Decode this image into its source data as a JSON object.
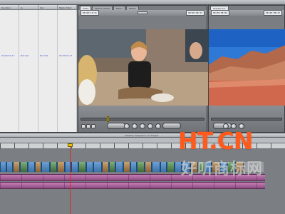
{
  "browser": {
    "columns": [
      "Duration",
      "In",
      "Out",
      "Media Start"
    ],
    "selected_row": [
      "00:00:01:17",
      "Not Set",
      "Not Set",
      "00:00:01:17"
    ]
  },
  "viewer": {
    "tabs": [
      "Video",
      "Stereo (a1a2)",
      "Filters",
      "Motion"
    ],
    "timecode_left": "00:00:14:31",
    "timecode_right": "00:00:00:27"
  },
  "canvas": {
    "tabs": [
      "Sequence 1"
    ],
    "timecode_left": "00:00:08:04",
    "timecode_right": "00:00:08:27"
  },
  "timeline": {
    "title": "Timeline: Sequence 1 in Project",
    "playhead_fraction": 0.245
  },
  "watermark": {
    "logo": "HT.CN",
    "tagline": "好听商标网"
  },
  "colors": {
    "video_clip": "#4a7fb5",
    "audio_clip": "#b06aa0",
    "logo": "#ff5a1c"
  }
}
